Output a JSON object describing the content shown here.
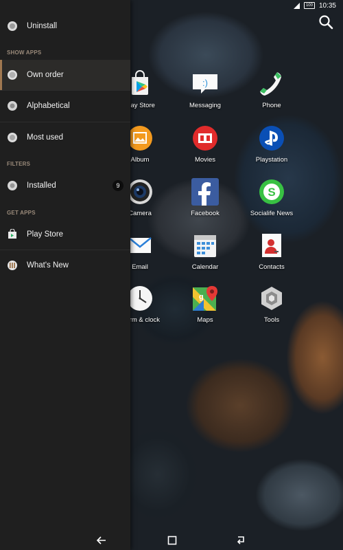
{
  "status_bar": {
    "battery": "100",
    "time": "10:35"
  },
  "apps": [
    {
      "label": "Play Store",
      "icon": "play-store-icon"
    },
    {
      "label": "Messaging",
      "icon": "messaging-icon"
    },
    {
      "label": "Phone",
      "icon": "phone-icon"
    },
    {
      "label": "Album",
      "icon": "album-icon"
    },
    {
      "label": "Movies",
      "icon": "movies-icon"
    },
    {
      "label": "Playstation",
      "icon": "playstation-icon"
    },
    {
      "label": "Camera",
      "icon": "camera-icon"
    },
    {
      "label": "Facebook",
      "icon": "facebook-icon"
    },
    {
      "label": "Socialife News",
      "icon": "socialife-icon"
    },
    {
      "label": "Email",
      "icon": "email-icon"
    },
    {
      "label": "Calendar",
      "icon": "calendar-icon"
    },
    {
      "label": "Contacts",
      "icon": "contacts-icon"
    },
    {
      "label": "Alarm & clock",
      "icon": "clock-icon"
    },
    {
      "label": "Maps",
      "icon": "maps-icon"
    },
    {
      "label": "Tools",
      "icon": "tools-icon"
    }
  ],
  "drawer": {
    "uninstall": "Uninstall",
    "show_apps_header": "SHOW APPS",
    "own_order": "Own order",
    "alphabetical": "Alphabetical",
    "most_used": "Most used",
    "filters_header": "FILTERS",
    "installed": "Installed",
    "installed_count": "9",
    "get_apps_header": "GET APPS",
    "play_store": "Play Store",
    "whats_new": "What's New"
  },
  "colors": {
    "drawer_bg": "#1f1f1f",
    "accent": "#a07850",
    "section_header": "#9a8a7a"
  }
}
